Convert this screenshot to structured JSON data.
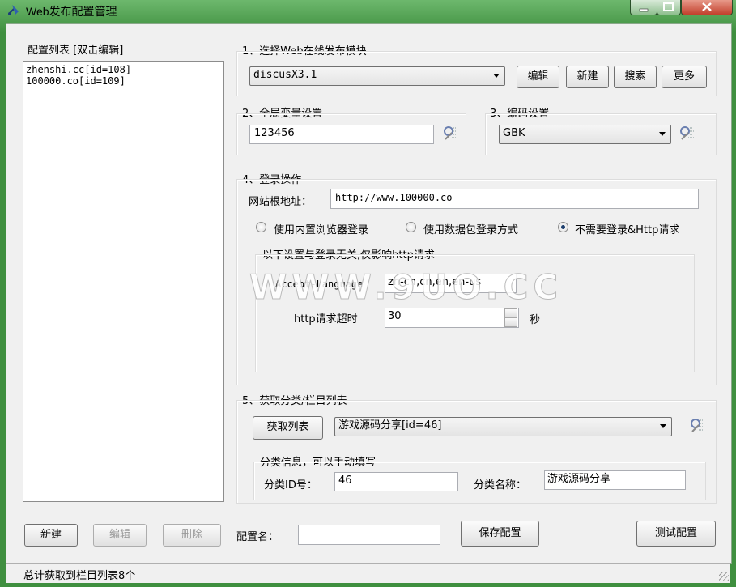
{
  "window": {
    "title": "Web发布配置管理",
    "buttons": [
      "minimize",
      "maximize",
      "close"
    ],
    "accent_color": "#3f8f3f"
  },
  "config_list": {
    "label": "配置列表  [双击编辑]",
    "items": [
      "zhenshi.cc[id=108]",
      "100000.co[id=109]"
    ],
    "new_label": "新建",
    "edit_label": "编辑",
    "delete_label": "删除"
  },
  "section1": {
    "title": "1、选择Web在线发布模块",
    "module_value": "discusX3.1",
    "edit_label": "编辑",
    "new_label": "新建",
    "search_label": "搜索",
    "more_label": "更多"
  },
  "section2": {
    "title": "2、全局变量设置",
    "value": "123456"
  },
  "section3": {
    "title": "3、编码设置",
    "value": "GBK"
  },
  "section4": {
    "title": "4、登录操作",
    "root_url_label": "网站根地址：",
    "root_url_value": "http://www.100000.co",
    "radio1": "使用内置浏览器登录",
    "radio2": "使用数据包登录方式",
    "radio3": "不需要登录&Http请求",
    "selected_radio": "radio3",
    "http_group_title": "以下设置与登录无关,仅影响http请求",
    "accept_language_label": "Accept-Language",
    "accept_language_value": "zh-cn,cn,en,en-us",
    "timeout_label": "http请求超时",
    "timeout_value": "30",
    "timeout_unit": "秒"
  },
  "section5": {
    "title": "5、获取分类/栏目列表",
    "fetch_label": "获取列表",
    "category_value": "游戏源码分享[id=46]",
    "info_title": "分类信息，可以手动填写",
    "id_label": "分类ID号：",
    "id_value": "46",
    "name_label": "分类名称：",
    "name_value": "游戏源码分享"
  },
  "bottom": {
    "config_name_label": "配置名：",
    "config_name_value": "",
    "save_label": "保存配置",
    "test_label": "测试配置"
  },
  "status": {
    "text": "总计获取到栏目列表8个"
  },
  "watermark": {
    "text": "WWW.9UO.CC"
  }
}
